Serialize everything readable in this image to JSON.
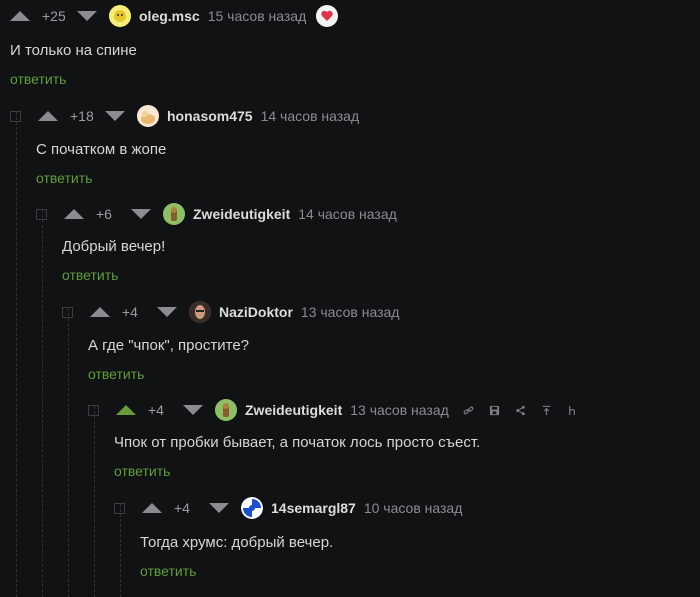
{
  "comments": [
    {
      "rating": "+25",
      "user": "oleg.msc",
      "time": "15 часов назад",
      "text": "И только на спине",
      "reply": "ответить"
    },
    {
      "rating": "+18",
      "user": "honasom475",
      "time": "14 часов назад",
      "text": "С початком в жопе",
      "reply": "ответить"
    },
    {
      "rating": "+6",
      "user": "Zweideutigkeit",
      "time": "14 часов назад",
      "text": "Добрый вечер!",
      "reply": "ответить"
    },
    {
      "rating": "+4",
      "user": "NaziDoktor",
      "time": "13 часов назад",
      "text": "А где \"чпок\", простите?",
      "reply": "ответить"
    },
    {
      "rating": "+4",
      "user": "Zweideutigkeit",
      "time": "13 часов назад",
      "text": "Чпок от пробки бывает, а початок лось просто съест.",
      "reply": "ответить"
    },
    {
      "rating": "+4",
      "user": "14semargl87",
      "time": "10 часов назад",
      "text": "Тогда хрумс: добрый вечер.",
      "reply": "ответить"
    }
  ],
  "icons": {
    "tools": [
      "link-icon",
      "save-icon",
      "share-icon",
      "go-to-parent-icon",
      "more-icon"
    ]
  },
  "colors": {
    "background": "#111214",
    "reply": "#5f9e3c",
    "upvote_active": "#6a9b3a"
  }
}
